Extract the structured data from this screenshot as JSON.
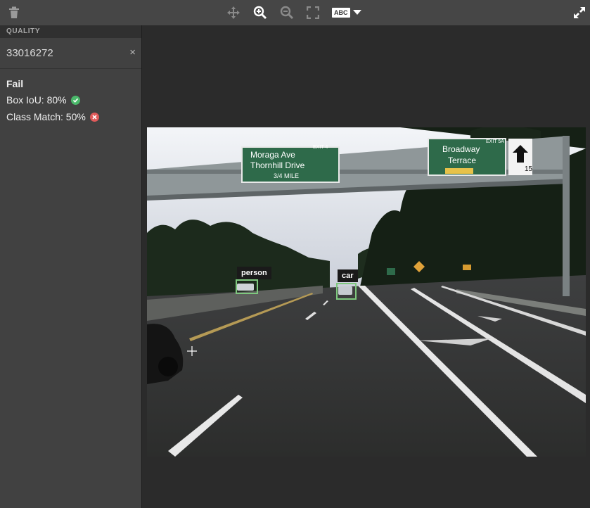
{
  "toolbar": {
    "icons": [
      "trash-icon",
      "move-icon",
      "zoom-in-icon",
      "zoom-out-icon",
      "fit-screen-icon",
      "label-toggle-icon",
      "expand-icon"
    ],
    "label_toggle_text": "ABC"
  },
  "sidebar": {
    "section_title": "QUALITY",
    "item_id": "33016272",
    "close_label": "×",
    "status": "Fail",
    "metrics": [
      {
        "label": "Box IoU: 80%",
        "state": "pass"
      },
      {
        "label": "Class Match: 50%",
        "state": "fail"
      }
    ]
  },
  "image": {
    "signs": {
      "left_line1": "Moraga Ave",
      "left_line2": "Thornhill Drive",
      "left_line3": "3/4 MILE",
      "left_exit": "EXIT 4",
      "right_line1": "Broadway",
      "right_line2": "Terrace",
      "right_exit": "EXIT 5A",
      "right_route": "15"
    },
    "annotations": [
      {
        "label": "person"
      },
      {
        "label": "car"
      }
    ]
  },
  "colors": {
    "toolbar": "#464646",
    "sidebar": "#414141",
    "canvas": "#2b2b2b",
    "pass": "#4ab86a",
    "fail": "#e05a5a",
    "bbox": "#7ec87e"
  }
}
